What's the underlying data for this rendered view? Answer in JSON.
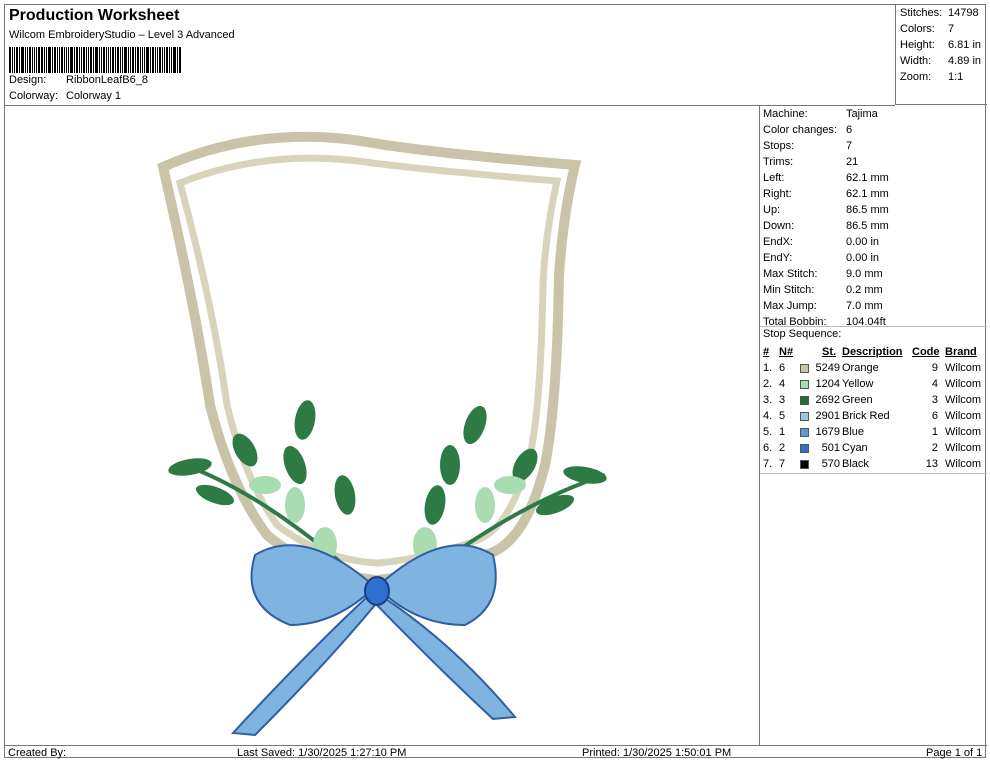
{
  "header": {
    "title": "Production Worksheet",
    "subtitle": "Wilcom EmbroideryStudio – Level 3 Advanced",
    "design_label": "Design:",
    "design_value": "RibbonLeafB6_8",
    "colorway_label": "Colorway:",
    "colorway_value": "Colorway 1"
  },
  "stats": {
    "stitches_label": "Stitches:",
    "stitches": "14798",
    "colors_label": "Colors:",
    "colors": "7",
    "height_label": "Height:",
    "height": "6.81 in",
    "width_label": "Width:",
    "width": "4.89 in",
    "zoom_label": "Zoom:",
    "zoom": "1:1"
  },
  "machine_info": [
    {
      "label": "Machine:",
      "value": "Tajima"
    },
    {
      "label": "Color changes:",
      "value": "6"
    },
    {
      "label": "Stops:",
      "value": "7"
    },
    {
      "label": "Trims:",
      "value": "21"
    },
    {
      "label": "Left:",
      "value": "62.1 mm"
    },
    {
      "label": "Right:",
      "value": "62.1 mm"
    },
    {
      "label": "Up:",
      "value": "86.5 mm"
    },
    {
      "label": "Down:",
      "value": "86.5 mm"
    },
    {
      "label": "EndX:",
      "value": "0.00 in"
    },
    {
      "label": "EndY:",
      "value": "0.00 in"
    },
    {
      "label": "Max Stitch:",
      "value": "9.0 mm"
    },
    {
      "label": "Min Stitch:",
      "value": "0.2 mm"
    },
    {
      "label": "Max Jump:",
      "value": "7.0 mm"
    },
    {
      "label": "Total Bobbin:",
      "value": "104.04ft"
    }
  ],
  "stop_sequence": {
    "title": "Stop Sequence:",
    "headers": {
      "num": "#",
      "n": "N#",
      "st": "St.",
      "desc": "Description",
      "code": "Code",
      "brand": "Brand"
    },
    "rows": [
      {
        "num": "1.",
        "n": "6",
        "color": "#c9c4a8",
        "st": "5249",
        "desc": "Orange",
        "code": "9",
        "brand": "Wilcom"
      },
      {
        "num": "2.",
        "n": "4",
        "color": "#a9dcb0",
        "st": "1204",
        "desc": "Yellow",
        "code": "4",
        "brand": "Wilcom"
      },
      {
        "num": "3.",
        "n": "3",
        "color": "#1e6e3a",
        "st": "2692",
        "desc": "Green",
        "code": "3",
        "brand": "Wilcom"
      },
      {
        "num": "4.",
        "n": "5",
        "color": "#9cc3e8",
        "st": "2901",
        "desc": "Brick Red",
        "code": "6",
        "brand": "Wilcom"
      },
      {
        "num": "5.",
        "n": "1",
        "color": "#5a9ad6",
        "st": "1679",
        "desc": "Blue",
        "code": "1",
        "brand": "Wilcom"
      },
      {
        "num": "6.",
        "n": "2",
        "color": "#2e6fcf",
        "st": "501",
        "desc": "Cyan",
        "code": "2",
        "brand": "Wilcom"
      },
      {
        "num": "7.",
        "n": "7",
        "color": "#000000",
        "st": "570",
        "desc": "Black",
        "code": "13",
        "brand": "Wilcom"
      }
    ]
  },
  "footer": {
    "created_by": "Created By:",
    "last_saved": "Last Saved: 1/30/2025 1:27:10 PM",
    "printed": "Printed: 1/30/2025 1:50:01 PM",
    "page": "Page 1 of 1"
  }
}
